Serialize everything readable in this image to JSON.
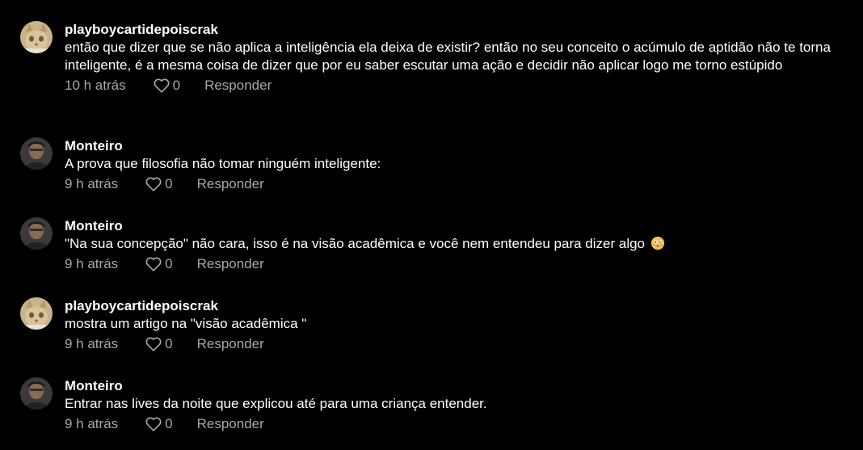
{
  "comments": [
    {
      "username": "playboycartidepoiscrak",
      "avatar": "cat-avatar",
      "text": "então que dizer que se não aplica a inteligência ela deixa de existir? então no seu conceito o acúmulo de aptidão não te torna inteligente, é a mesma coisa de dizer que por eu saber escutar uma ação e decidir não aplicar logo me torno estúpido",
      "time": "10 h atrás",
      "likes": "0",
      "reply_label": "Responder"
    },
    {
      "username": "Monteiro",
      "avatar": "person-avatar",
      "text": "A prova que filosofia não tomar ninguém inteligente:",
      "time": "9 h atrás",
      "likes": "0",
      "reply_label": "Responder"
    },
    {
      "username": "Monteiro",
      "avatar": "person-avatar",
      "text": "\"Na sua concepção\" não cara, isso é na visão acadêmica e você nem entendeu para dizer algo",
      "emoji": "flushed-face-emoji",
      "time": "9 h atrás",
      "likes": "0",
      "reply_label": "Responder"
    },
    {
      "username": "playboycartidepoiscrak",
      "avatar": "cat-avatar",
      "text": "mostra um artigo na \"visão acadêmica \"",
      "time": "9 h atrás",
      "likes": "0",
      "reply_label": "Responder"
    },
    {
      "username": "Monteiro",
      "avatar": "person-avatar",
      "text": "Entrar nas lives da noite que explicou até para uma criança entender.",
      "time": "9 h atrás",
      "likes": "0",
      "reply_label": "Responder"
    }
  ],
  "colors": {
    "background": "#000000",
    "text": "#ffffff",
    "secondary": "#a8a8a8"
  },
  "icons": {
    "like": "heart-outline-icon"
  }
}
